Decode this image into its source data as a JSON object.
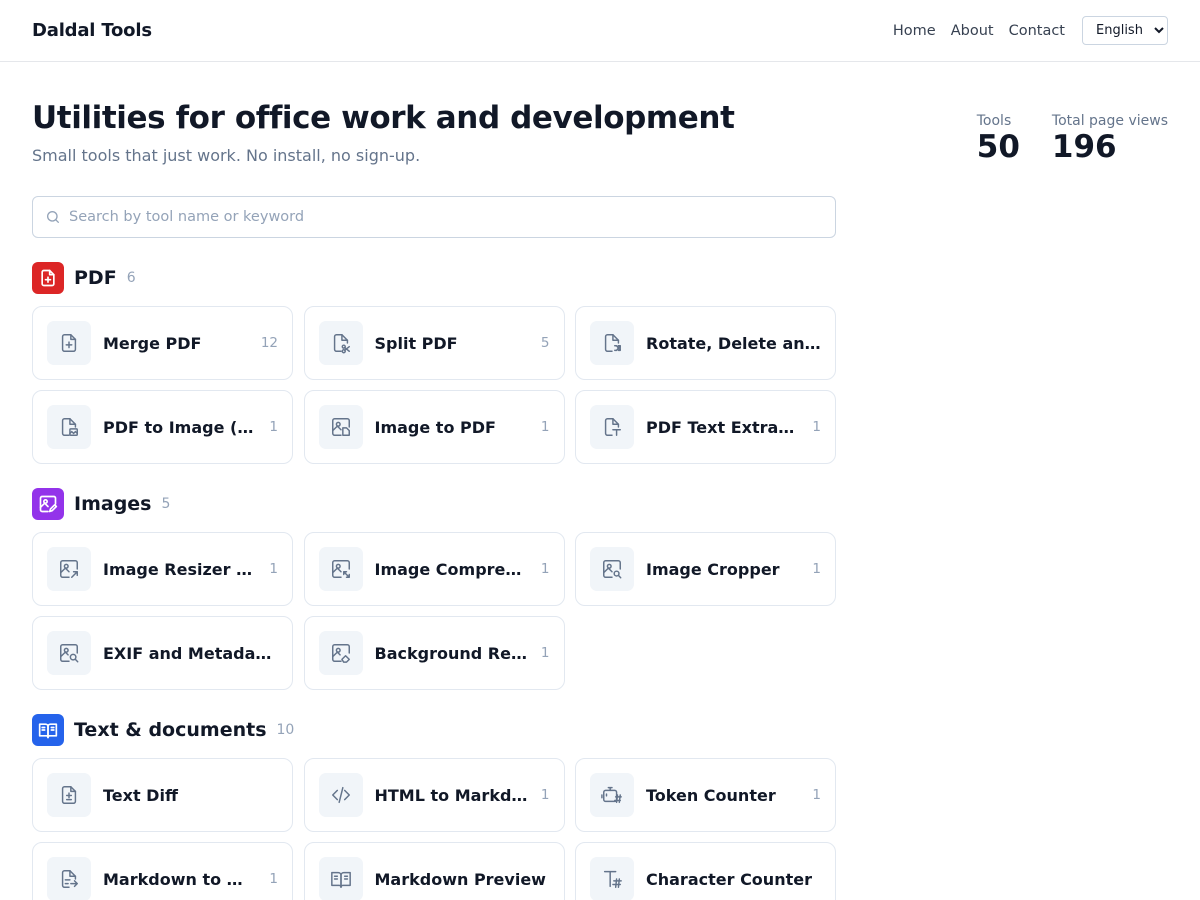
{
  "header": {
    "brand": "Daldal Tools",
    "nav": [
      "Home",
      "About",
      "Contact"
    ],
    "language": "English"
  },
  "hero": {
    "title": "Utilities for office work and development",
    "subtitle": "Small tools that just work. No install, no sign-up."
  },
  "stats": [
    {
      "label": "Tools",
      "value": "50"
    },
    {
      "label": "Total page views",
      "value": "196"
    }
  ],
  "search": {
    "placeholder": "Search by tool name or keyword"
  },
  "colors": {
    "pdf": "#dc2626",
    "images": "#9333ea",
    "text": "#2563eb"
  },
  "categories": [
    {
      "title": "PDF",
      "count": "6",
      "icon": "file-plus-icon",
      "tools": [
        {
          "name": "Merge PDF",
          "count": "12",
          "icon": "file-plus-icon"
        },
        {
          "name": "Split PDF",
          "count": "5",
          "icon": "file-scissors-icon"
        },
        {
          "name": "Rotate, Delete and R…",
          "count": "",
          "icon": "file-shuffle-icon"
        },
        {
          "name": "PDF to Image (PN…",
          "count": "1",
          "icon": "file-image-icon"
        },
        {
          "name": "Image to PDF",
          "count": "1",
          "icon": "image-file-icon"
        },
        {
          "name": "PDF Text Extractor",
          "count": "1",
          "icon": "file-text-icon"
        }
      ]
    },
    {
      "title": "Images",
      "count": "5",
      "icon": "image-edit-icon",
      "tools": [
        {
          "name": "Image Resizer an…",
          "count": "1",
          "icon": "image-resize-icon"
        },
        {
          "name": "Image Compressor",
          "count": "1",
          "icon": "image-compress-icon"
        },
        {
          "name": "Image Cropper",
          "count": "1",
          "icon": "image-crop-icon"
        },
        {
          "name": "EXIF and Metadata R…",
          "count": "",
          "icon": "image-search-icon"
        },
        {
          "name": "Background Rem…",
          "count": "1",
          "icon": "image-eraser-icon"
        }
      ]
    },
    {
      "title": "Text & documents",
      "count": "10",
      "icon": "book-open-icon",
      "tools": [
        {
          "name": "Text Diff",
          "count": "",
          "icon": "file-diff-icon"
        },
        {
          "name": "HTML to Markdown",
          "count": "1",
          "icon": "code-icon"
        },
        {
          "name": "Token Counter",
          "count": "1",
          "icon": "bot-hash-icon"
        },
        {
          "name": "Markdown to Word",
          "count": "1",
          "icon": "file-export-icon"
        },
        {
          "name": "Markdown Preview",
          "count": "",
          "icon": "book-open-icon"
        },
        {
          "name": "Character Counter",
          "count": "",
          "icon": "text-hash-icon"
        }
      ]
    }
  ]
}
